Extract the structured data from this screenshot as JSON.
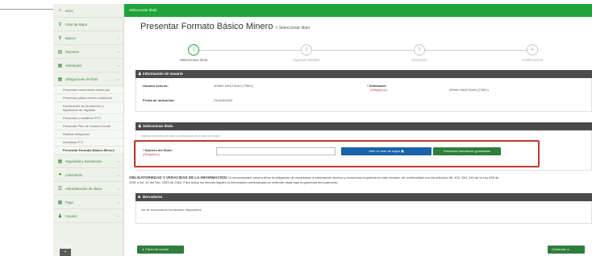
{
  "sidebar": {
    "items": [
      {
        "label": "Inicio",
        "icon": "home-icon",
        "glyph": "⌂"
      },
      {
        "label": "Visor de Mapa",
        "icon": "map-marker-icon",
        "glyph": "⚲"
      },
      {
        "label": "Buscar",
        "icon": "search-icon",
        "glyph": "⚲"
      },
      {
        "label": "Reportes",
        "icon": "report-icon",
        "glyph": "▤"
      },
      {
        "label": "Solicitudes",
        "icon": "grid-icon",
        "glyph": "▦"
      },
      {
        "label": "Obligaciones de título",
        "icon": "grid-icon",
        "glyph": "▦"
      }
    ],
    "subitems": [
      "Presentar instrumento ambiental",
      "Presentar póliza minero ambiental",
      "Declaración de producción y liquidación de regalías",
      "Presentar y modificar PTO",
      "Presentar Plan de Gestión Social",
      "Radicar obligación",
      "Actualizar PTI",
      "Presentar Formato Básico Minero"
    ],
    "bottom_items": [
      {
        "label": "Seguridad y Salvamento",
        "icon": "grid-icon",
        "glyph": "▦"
      },
      {
        "label": "Laboratorio",
        "icon": "lab-icon",
        "glyph": "●"
      },
      {
        "label": "Administración de títulos",
        "icon": "list-icon",
        "glyph": "☰"
      },
      {
        "label": "Pago",
        "icon": "grid-icon",
        "glyph": "▦"
      },
      {
        "label": "Usuario",
        "icon": "user-icon",
        "glyph": "♟"
      }
    ],
    "chevron": "»",
    "collapse_glyph": "«"
  },
  "header": {
    "bar_label": "Seleccionar título",
    "title": "Presentar Formato Básico Minero",
    "title_sub": "> Seleccionar título"
  },
  "steps": [
    {
      "number": "1",
      "label": "Seleccionar título",
      "active": true
    },
    {
      "number": "2",
      "label": "Ingresar detalles",
      "active": false
    },
    {
      "number": "3",
      "label": "Resumen",
      "active": false
    },
    {
      "number": "4",
      "label": "Confirmación",
      "active": false
    }
  ],
  "user_info": {
    "heading": "Información de usuario",
    "user_label": "Usuario externo:",
    "user_value": "JENNY BASTIDAS (73521)",
    "date_label": "Fecha de radicación:",
    "date_value": "29/JUN/2020",
    "applicant_label": "* Solicitante:",
    "applicant_required": "(Obligatorio)",
    "applicant_value": "JENNY BASTIDAS (73521)"
  },
  "select_title": {
    "heading": "Seleccionar título",
    "hint": "Ingrese el número del título o selecciónelo en el visor de mapa.",
    "number_label": "* Número del título:",
    "number_required": "(Obligatorio)",
    "number_value": "",
    "map_button": "Abrir el visor de mapa",
    "drafts_button": "Encontrar borradores guardados"
  },
  "notice": {
    "bold": "OBLIGATORIEDAD Y VERACIDAD DE LA INFORMACIÓN:",
    "line1": "El concesionario minero tiene la obligación de suministrar la información técnica y económica requerida en este formato, de conformidad con los artículos 88, 100, 339, 340 de la Ley 685 de",
    "line2": "2001 y Art. 10 del Dto. 1993 de 2002. Para todos los efectos legales la información suministrada se entiende dada bajo la gravedad del juramento."
  },
  "drafts": {
    "heading": "Borradores",
    "empty": "No se encontraron borradores disponibles."
  },
  "footer": {
    "panel_button": "Panel de control",
    "continue_button": "Continuar"
  },
  "colors": {
    "brand_green": "#1fa33a",
    "dark_green": "#2f7d3b",
    "blue": "#1a63a8",
    "highlight_red": "#c0392b"
  }
}
